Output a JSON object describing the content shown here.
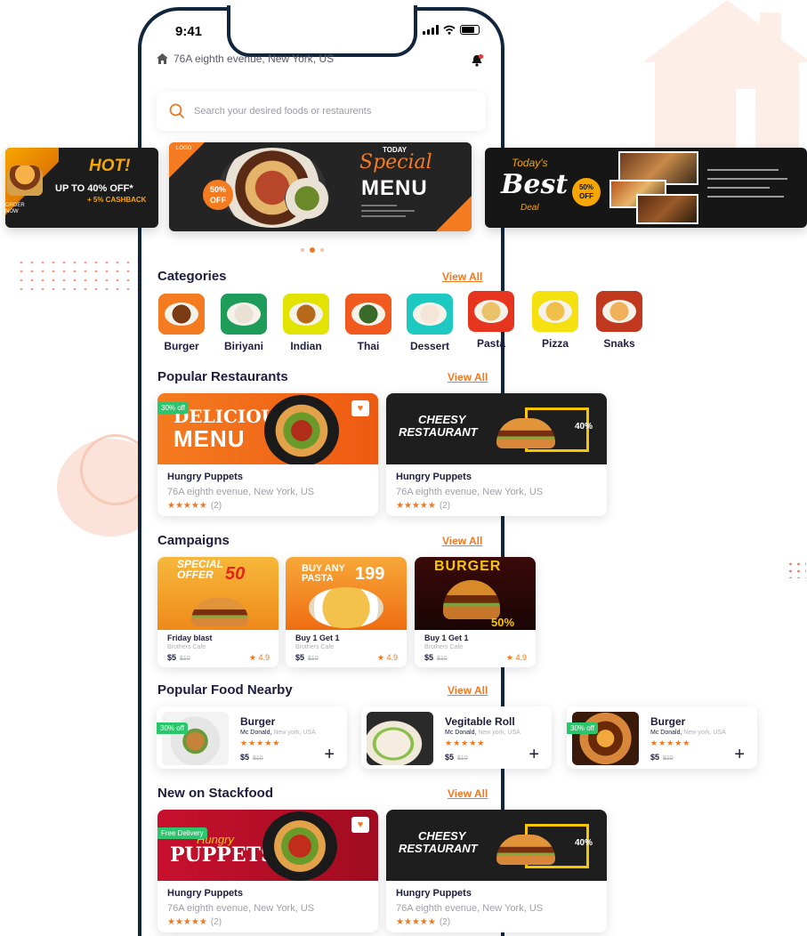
{
  "status": {
    "time": "9:41"
  },
  "location": {
    "address": "76A eighth evenue, New York, US"
  },
  "search": {
    "placeholder": "Search your desired foods or restaurents"
  },
  "banners": {
    "left": {
      "hot": "HOT!",
      "offer": "UP TO 40% OFF*",
      "cashback": "+ 5% CASHBACK",
      "cta": "ORDER NOW"
    },
    "mid": {
      "today": "TODAY",
      "special": "Special",
      "menu": "MENU",
      "discount": "50%",
      "off": "OFF",
      "logo": "LOGO"
    },
    "right": {
      "todays": "Today's",
      "best": "Best",
      "deal": "Deal",
      "discount": "50%",
      "off": "OFF"
    }
  },
  "categories": {
    "title": "Categories",
    "view_all": "View All",
    "items": [
      {
        "label": "Burger",
        "bg": "#f47b20"
      },
      {
        "label": "Biriyani",
        "bg": "#1e9c5a"
      },
      {
        "label": "Indian",
        "bg": "#e3e300"
      },
      {
        "label": "Thai",
        "bg": "#f15a1f"
      },
      {
        "label": "Dessert",
        "bg": "#1ec9c2"
      },
      {
        "label": "Pasta",
        "bg": "#e6351e"
      },
      {
        "label": "Pizza",
        "bg": "#f4e10f"
      },
      {
        "label": "Snaks",
        "bg": "#c0381d"
      }
    ]
  },
  "popular_restaurants": {
    "title": "Popular Restaurants",
    "view_all": "View All",
    "items": [
      {
        "name": "Hungry Puppets",
        "location": "76A eighth evenue, New York, US",
        "reviews": "(2)",
        "badge": "30% off",
        "banner_big": "DELICIOUS",
        "banner_sub": "MENU"
      },
      {
        "name": "Hungry Puppets",
        "location": "76A eighth evenue, New York, US",
        "reviews": "(2)",
        "banner_big": "CHEESY",
        "banner_sub": "RESTAURANT",
        "discount": "40%"
      }
    ]
  },
  "campaigns": {
    "title": "Campaigns",
    "view_all": "View All",
    "items": [
      {
        "name": "Friday blast",
        "sub": "Brothers Cafe",
        "price": "$5",
        "old": "$10",
        "rating": "4.9",
        "banner": "SPECIAL OFFER",
        "pct": "50"
      },
      {
        "name": "Buy 1 Get 1",
        "sub": "Brothers Cafe",
        "price": "$5",
        "old": "$10",
        "rating": "4.9",
        "banner": "BUY ANY PASTA",
        "pct": "199"
      },
      {
        "name": "Buy 1 Get 1",
        "sub": "Brothers Cafe",
        "price": "$5",
        "old": "$10",
        "rating": "4.9",
        "banner": "BURGER",
        "pct": "50%"
      }
    ]
  },
  "popular_nearby": {
    "title": "Popular Food Nearby",
    "view_all": "View All",
    "items": [
      {
        "name": "Burger",
        "shop": "Mc Donald,",
        "city": "New york, USA",
        "price": "$5",
        "old": "$10",
        "badge": "30% off"
      },
      {
        "name": "Vegitable Roll",
        "shop": "Mc Donald,",
        "city": "New york, USA",
        "price": "$5",
        "old": "$10"
      },
      {
        "name": "Burger",
        "shop": "Mc Donald,",
        "city": "New york, USA",
        "price": "$5",
        "old": "$10",
        "badge": "30% off"
      }
    ]
  },
  "new_on_stackfood": {
    "title": "New on Stackfood",
    "view_all": "View All",
    "items": [
      {
        "name": "Hungry Puppets",
        "location": "76A eighth evenue, New York, US",
        "reviews": "(2)",
        "badge": "Free Delivery",
        "banner_big": "PUPPETS",
        "banner_sub": "Hungry"
      },
      {
        "name": "Hungry Puppets",
        "location": "76A eighth evenue, New York, US",
        "reviews": "(2)",
        "banner_big": "CHEESY",
        "banner_sub": "RESTAURANT",
        "discount": "40%"
      }
    ]
  },
  "stars": "★★★★★",
  "plus": "+",
  "heart": "♥",
  "star_single": "★"
}
